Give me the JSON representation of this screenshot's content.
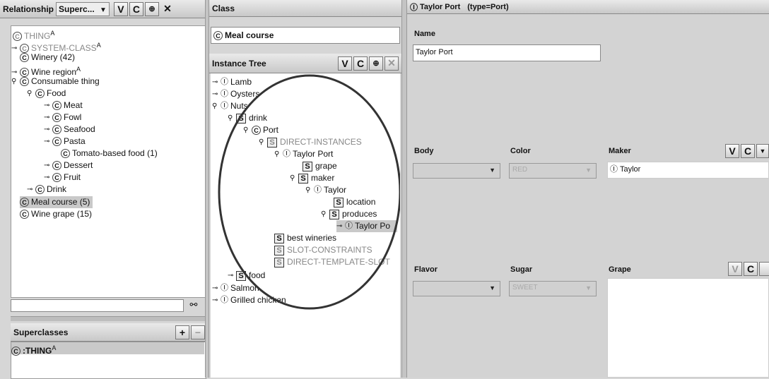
{
  "left": {
    "title": "Relationship",
    "dropdown_value": "Superc...",
    "buttons": [
      "V",
      "C",
      "⊕",
      "✕"
    ],
    "tree": [
      {
        "label": "THING",
        "suffix": "A",
        "gray": true
      },
      {
        "label": "SYSTEM-CLASS",
        "suffix": "A",
        "gray": true
      },
      {
        "label": "Winery  (42)"
      },
      {
        "label": "Wine region",
        "suffix": "A"
      },
      {
        "label": "Consumable thing"
      },
      {
        "label": "Food"
      },
      {
        "label": "Meat"
      },
      {
        "label": "Fowl"
      },
      {
        "label": "Seafood"
      },
      {
        "label": "Pasta"
      },
      {
        "label": "Tomato-based food  (1)"
      },
      {
        "label": "Dessert"
      },
      {
        "label": "Fruit"
      },
      {
        "label": "Drink"
      },
      {
        "label": "Meal course  (5)"
      },
      {
        "label": "Wine grape  (15)"
      }
    ],
    "search_value": "",
    "superclasses_title": "Superclasses",
    "super_buttons": [
      "+",
      "−"
    ],
    "superclass_item": ":THING",
    "superclass_suffix": "A"
  },
  "middle": {
    "class_title": "Class",
    "class_value": "Meal course",
    "instance_tree_title": "Instance Tree",
    "buttons": [
      "V",
      "C",
      "⊕",
      "✕"
    ],
    "tree": [
      {
        "label": "Lamb"
      },
      {
        "label": "Oysters"
      },
      {
        "label": "Nuts"
      },
      {
        "label": "drink"
      },
      {
        "label": "Port"
      },
      {
        "label": "DIRECT-INSTANCES"
      },
      {
        "label": "Taylor Port"
      },
      {
        "label": "grape"
      },
      {
        "label": "maker"
      },
      {
        "label": "Taylor"
      },
      {
        "label": "location"
      },
      {
        "label": "produces"
      },
      {
        "label": "Taylor Po"
      },
      {
        "label": "best wineries"
      },
      {
        "label": "SLOT-CONSTRAINTS"
      },
      {
        "label": "DIRECT-TEMPLATE-SLOT"
      },
      {
        "label": "food"
      },
      {
        "label": "Salmon"
      },
      {
        "label": "Grilled chicken"
      }
    ]
  },
  "right": {
    "title": "Taylor Port",
    "type": "(type=Port)",
    "name_label": "Name",
    "name_value": "Taylor Port",
    "body_label": "Body",
    "body_value": "",
    "color_label": "Color",
    "color_value": "RED",
    "maker_label": "Maker",
    "maker_value": "Taylor",
    "maker_buttons": [
      "V",
      "C"
    ],
    "flavor_label": "Flavor",
    "flavor_value": "",
    "sugar_label": "Sugar",
    "sugar_value": "SWEET",
    "grape_label": "Grape",
    "grape_buttons": [
      "V",
      "C"
    ]
  }
}
